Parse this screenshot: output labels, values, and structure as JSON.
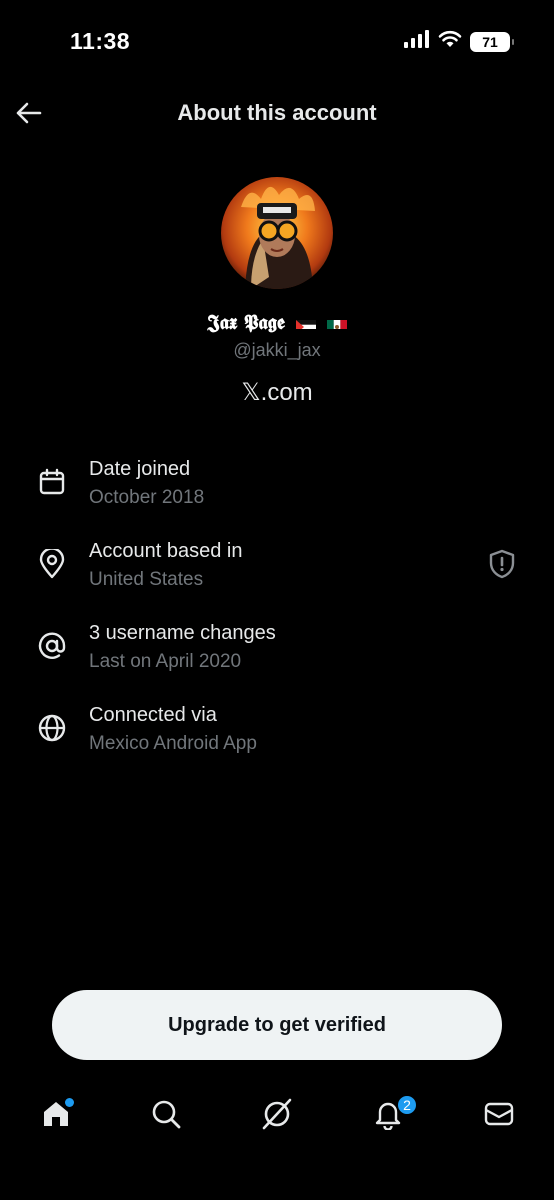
{
  "status_bar": {
    "time": "11:38",
    "battery": "71"
  },
  "header": {
    "title": "About this account",
    "back_icon": "arrow-left-icon"
  },
  "profile": {
    "display_name": "𝕵𝖆𝖝 𝕻𝖆𝖌𝖊",
    "handle": "@jakki_jax",
    "site": "𝕏.com",
    "flags": [
      "palestine-flag",
      "mexico-flag"
    ]
  },
  "info": [
    {
      "icon": "calendar-icon",
      "label": "Date joined",
      "value": "October 2018"
    },
    {
      "icon": "location-pin-icon",
      "label": "Account based in",
      "value": "United States",
      "badge_icon": "shield-alert-icon"
    },
    {
      "icon": "at-sign-icon",
      "label": "3 username changes",
      "value": "Last on April 2020"
    },
    {
      "icon": "globe-icon",
      "label": "Connected via",
      "value": "Mexico Android App"
    }
  ],
  "cta": {
    "label": "Upgrade to get verified"
  },
  "tabs": [
    {
      "name": "home",
      "icon": "home-icon",
      "has_dot": true
    },
    {
      "name": "search",
      "icon": "search-icon"
    },
    {
      "name": "grok",
      "icon": "grok-icon"
    },
    {
      "name": "notifications",
      "icon": "bell-icon",
      "badge": "2"
    },
    {
      "name": "messages",
      "icon": "mail-icon"
    }
  ],
  "colors": {
    "background": "#000000",
    "text": "#e7e9ea",
    "muted": "#71767b",
    "accent": "#1d9bf0",
    "button_bg": "#eff3f4"
  }
}
